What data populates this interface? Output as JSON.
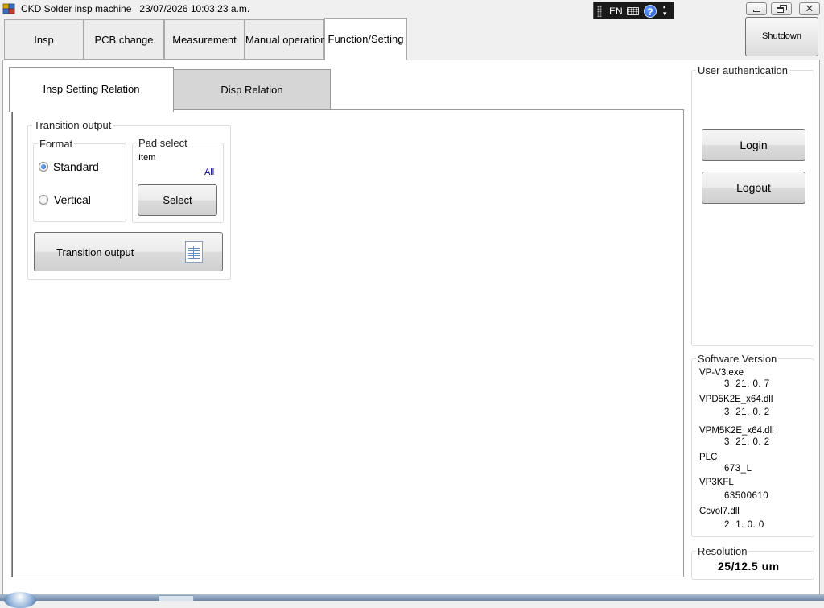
{
  "window": {
    "title": "CKD Solder insp machine",
    "datetime": "23/07/2026 10:03:23 a.m.",
    "close_glyph": "✕"
  },
  "langbar": {
    "language": "EN",
    "help_glyph": "?",
    "options_glyph": "▪\n▾"
  },
  "top_tabs": [
    {
      "label": "Insp",
      "active": false
    },
    {
      "label": "PCB change",
      "active": false
    },
    {
      "label": "Measurement",
      "active": false
    },
    {
      "label": "Manual operation",
      "active": false
    },
    {
      "label": "Function/Setting",
      "active": true
    }
  ],
  "shutdown_label": "Shutdown",
  "sub_tabs": [
    {
      "label": "Insp Setting Relation",
      "active": true
    },
    {
      "label": "Disp Relation",
      "active": false
    }
  ],
  "transition": {
    "group_label": "Transition output",
    "format": {
      "label": "Format",
      "options": [
        {
          "label": "Standard",
          "selected": true
        },
        {
          "label": "Vertical",
          "selected": false
        }
      ]
    },
    "pad_select": {
      "label": "Pad select",
      "item_label": "Item",
      "item_value": "All",
      "select_button": "Select"
    },
    "output_button": "Transition output"
  },
  "auth": {
    "label": "User authentication",
    "login": "Login",
    "logout": "Logout"
  },
  "software_version": {
    "label": "Software Version",
    "items": [
      {
        "name": "VP-V3.exe",
        "version": "3. 21. 0. 7"
      },
      {
        "name": "VPD5K2E_x64.dll",
        "version": "3. 21. 0. 2"
      },
      {
        "name": "VPM5K2E_x64.dll",
        "version": "3. 21. 0. 2"
      },
      {
        "name": "PLC",
        "version": "673_L"
      },
      {
        "name": "VP3KFL",
        "version": "63500610"
      },
      {
        "name": "Ccvol7.dll",
        "version": "2. 1. 0. 0"
      }
    ]
  },
  "resolution": {
    "label": "Resolution",
    "value": "25/12.5 um"
  },
  "colors": {
    "accent_blue": "#1a56b8",
    "item_value_color": "#000080"
  }
}
